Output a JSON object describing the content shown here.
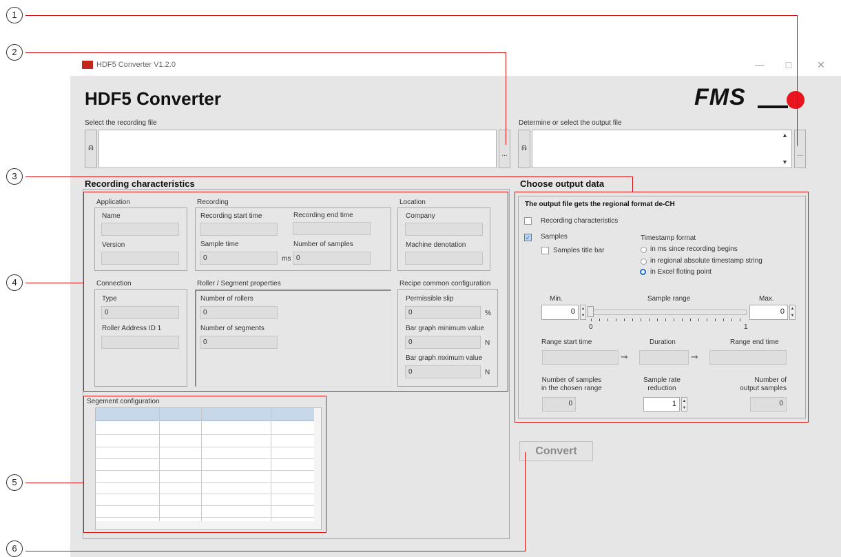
{
  "window": {
    "app_title": "HDF5  Converter  V1.2.0",
    "heading": "HDF5 Converter",
    "brand": "FMS",
    "controls": {
      "minimize": "—",
      "maximize": "□",
      "close": "✕"
    }
  },
  "files": {
    "input_label": "Select the recording file",
    "output_label": "Determine or select the output file",
    "input_value": "",
    "output_value": "",
    "browse_label": "...",
    "icon_glyph": "ᕱ"
  },
  "recording": {
    "section_title": "Recording characteristics",
    "application": {
      "title": "Application",
      "name_label": "Name",
      "name_value": "",
      "version_label": "Version",
      "version_value": ""
    },
    "recording": {
      "title": "Recording",
      "start_label": "Recording start time",
      "start_value": "",
      "end_label": "Recording end time",
      "end_value": "",
      "sample_time_label": "Sample time",
      "sample_time_value": "0",
      "sample_time_unit": "ms",
      "num_samples_label": "Number of samples",
      "num_samples_value": "0"
    },
    "location": {
      "title": "Location",
      "company_label": "Company",
      "company_value": "",
      "machine_label": "Machine denotation",
      "machine_value": ""
    },
    "connection": {
      "title": "Connection",
      "type_label": "Type",
      "type_value": "0",
      "roller_addr_label": "Roller Address ID 1",
      "roller_addr_value": ""
    },
    "roller": {
      "title": "Roller / Segment properties",
      "rollers_label": "Number of rollers",
      "rollers_value": "0",
      "segments_label": "Number of segments",
      "segments_value": "0"
    },
    "recipe": {
      "title": "Recipe common configuration",
      "slip_label": "Permissible slip",
      "slip_value": "0",
      "slip_unit": "%",
      "bar_min_label": "Bar graph minimum value",
      "bar_min_value": "0",
      "bar_min_unit": "N",
      "bar_max_label": "Bar graph mximum value",
      "bar_max_value": "0",
      "bar_max_unit": "N"
    }
  },
  "segment": {
    "title": "Segement configuration"
  },
  "output": {
    "section_title": "Choose output data",
    "regional_note": "The output file gets the regional format  de-CH",
    "recording_chk_label": "Recording characteristics",
    "recording_chk_checked": false,
    "samples_label": "Samples",
    "samples_checked": true,
    "samples_title_bar_label": "Samples title bar",
    "samples_title_bar_checked": false,
    "timestamp_title": "Timestamp format",
    "timestamp_options": [
      "in ms since recording begins",
      "in regional absolute timestamp string",
      "in Excel floting point"
    ],
    "timestamp_selected": 2,
    "min_label": "Min.",
    "sample_range_label": "Sample range",
    "max_label": "Max.",
    "min_value": "0",
    "max_value": "0",
    "slider_min_tick": "0",
    "slider_max_tick": "1",
    "range_start_label": "Range start time",
    "duration_label": "Duration",
    "range_end_label": "Range end time",
    "samples_in_range_label1": "Number of samples",
    "samples_in_range_label2": "in the chosen range",
    "samples_in_range_value": "0",
    "rate_reduction_label1": "Sample rate",
    "rate_reduction_label2": "reduction",
    "rate_reduction_value": "1",
    "output_samples_label1": "Number of",
    "output_samples_label2": "output samples",
    "output_samples_value": "0"
  },
  "convert_label": "Convert",
  "callouts": [
    "1",
    "2",
    "3",
    "4",
    "5",
    "6"
  ],
  "colors": {
    "callout_line": "#d11111",
    "brand_red": "#e8141e",
    "window_bg": "#e6e6e6"
  }
}
